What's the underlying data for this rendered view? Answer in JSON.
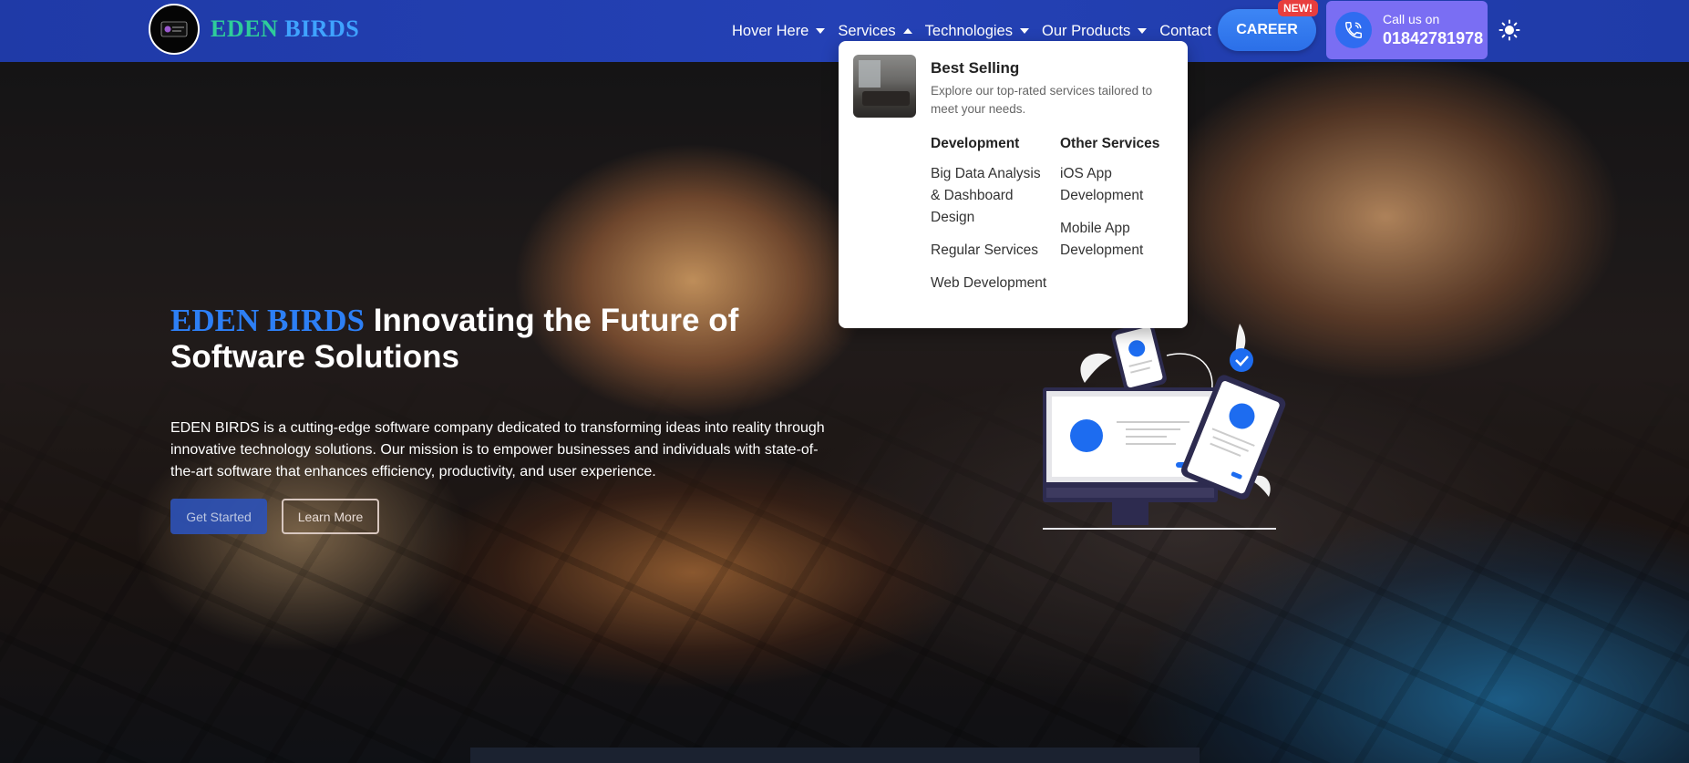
{
  "brand": {
    "part1": "EDEN",
    "part2": "BIRDS"
  },
  "nav": {
    "items": [
      {
        "label": "Hover Here",
        "caret": "down"
      },
      {
        "label": "Services",
        "caret": "up"
      },
      {
        "label": "Technologies",
        "caret": "down"
      },
      {
        "label": "Our Products",
        "caret": "down"
      },
      {
        "label": "Contact",
        "caret": "none"
      }
    ],
    "career_label": "CAREER",
    "new_badge": "NEW!",
    "call_label": "Call us on",
    "call_number": "01842781978"
  },
  "dropdown": {
    "title": "Best Selling",
    "subtitle": "Explore our top-rated services tailored to meet your needs.",
    "development": {
      "heading": "Development",
      "links": [
        "Big Data Analysis & Dashboard Design",
        "Regular Services",
        "Web Development"
      ]
    },
    "other": {
      "heading": "Other Services",
      "links": [
        "iOS App Development",
        "Mobile App Development"
      ]
    }
  },
  "hero": {
    "title_highlight": "EDEN BIRDS",
    "title_rest": " Innovating the Future of Software Solutions",
    "description": "EDEN BIRDS is a cutting-edge software company dedicated to transforming ideas into reality through innovative technology solutions. Our mission is to empower businesses and individuals with state-of-the-art software that enhances efficiency, productivity, and user experience.",
    "btn_primary": "Get Started",
    "btn_secondary": "Learn More"
  },
  "colors": {
    "header": "#2441b5",
    "accent": "#2d7ff5",
    "call_box": "#7a6ef3",
    "badge": "#e83e3e"
  },
  "icons": [
    "logo",
    "chevron-down-icon",
    "chevron-up-icon",
    "phone-icon",
    "sun-icon",
    "devices-illustration"
  ]
}
